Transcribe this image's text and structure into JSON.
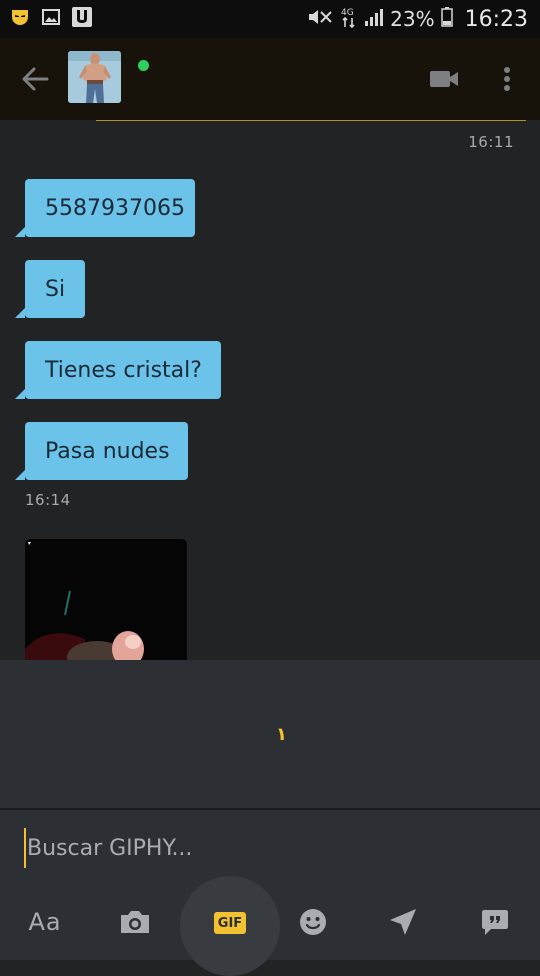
{
  "status_bar": {
    "battery_percent": "23%",
    "network": "4G",
    "time": "16:23"
  },
  "header": {
    "online": true,
    "online_color": "#2fcf5f"
  },
  "messages": {
    "timestamp_top": "16:11",
    "bubbles": [
      "5587937065",
      "Si",
      "Tienes cristal?",
      "Pasa nudes"
    ],
    "timestamp_mid": "16:14"
  },
  "gif_panel": {
    "loading_glyph": "١"
  },
  "input": {
    "placeholder": "Buscar GIPHY..."
  },
  "toolbar": {
    "text_label": "Aa",
    "gif_label": "GIF"
  },
  "colors": {
    "bubble": "#6cc3e9",
    "accent": "#f2c230",
    "header_bg": "#17120a",
    "chat_bg": "#222325",
    "panel_bg": "#2c2f33"
  }
}
